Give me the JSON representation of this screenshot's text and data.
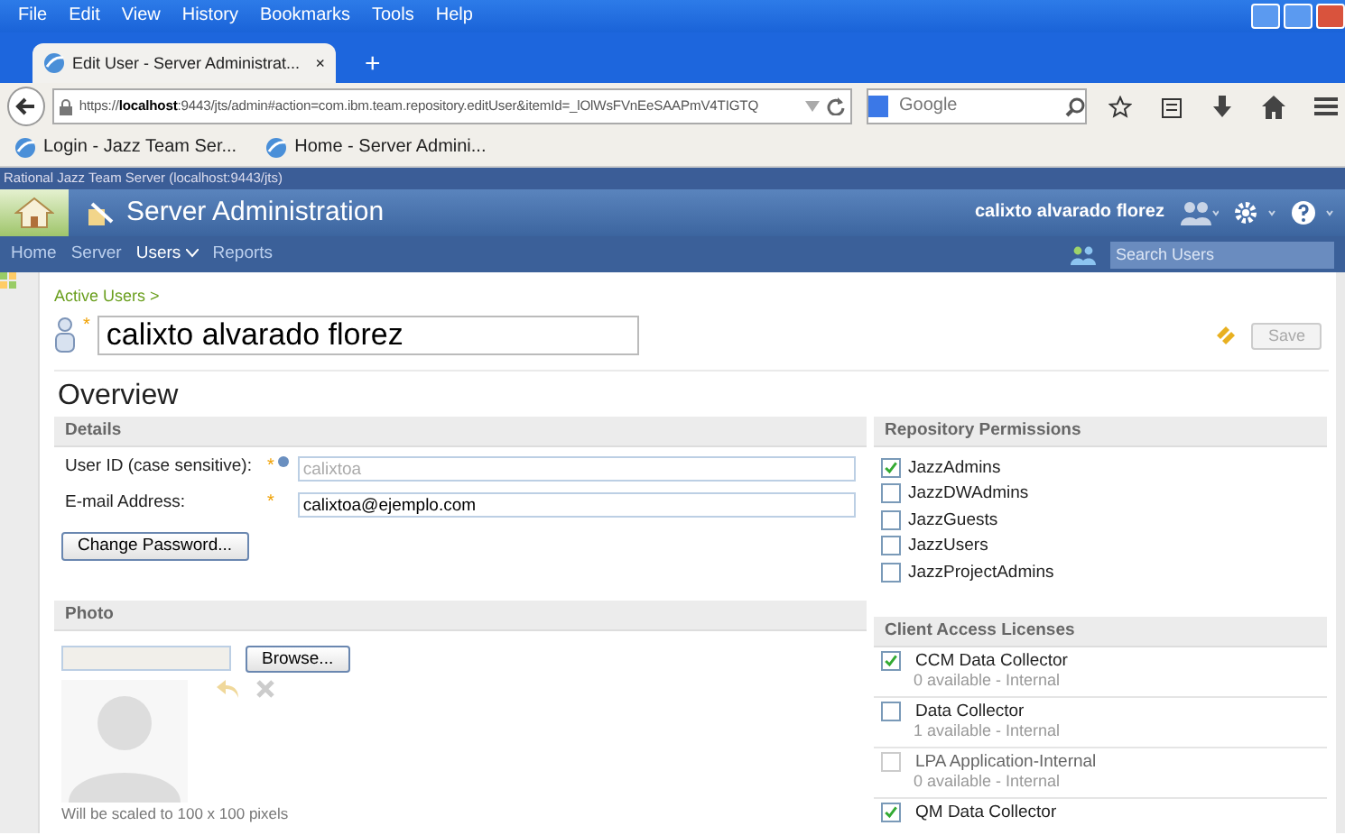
{
  "browser": {
    "menu": [
      "File",
      "Edit",
      "View",
      "History",
      "Bookmarks",
      "Tools",
      "Help"
    ],
    "tab": {
      "title": "Edit User - Server Administrat...",
      "close": "×"
    },
    "new_tab": "+",
    "url": "https://**localhost**:9443/jts/admin#action=com.ibm.team.repository.editUser&itemId=_lOlWsFVnEeSAAPmV4TIGTQ",
    "search": {
      "placeholder": "Google"
    },
    "bookmarks": [
      "Login - Jazz Team Ser...",
      "Home - Server Admini..."
    ]
  },
  "app": {
    "server_title": "Rational Jazz Team Server (localhost:9443/jts)",
    "title": "Server Administration",
    "user": "calixto alvarado florez",
    "nav": [
      {
        "label": "Home",
        "selected": false,
        "dropdown": false
      },
      {
        "label": "Server",
        "selected": false,
        "dropdown": false
      },
      {
        "label": "Users",
        "selected": true,
        "dropdown": true
      },
      {
        "label": "Reports",
        "selected": false,
        "dropdown": false
      }
    ],
    "search": {
      "placeholder": "Search Users"
    }
  },
  "page": {
    "breadcrumb": "Active Users >",
    "name": "calixto alvarado florez",
    "name_mark": "*",
    "save": "Save",
    "heading": "Overview"
  },
  "details": {
    "title": "Details",
    "fields": [
      {
        "label": "User ID (case sensitive):",
        "mark": "*",
        "value": "calixtoa",
        "disabled": true
      },
      {
        "label": "E-mail Address:",
        "mark": "*",
        "value": "calixtoa@ejemplo.com",
        "disabled": false
      }
    ],
    "change_password": "Change Password..."
  },
  "photo": {
    "title": "Photo",
    "browse": "Browse...",
    "note": "Will be scaled to 100 x 100 pixels"
  },
  "permissions": {
    "title": "Repository Permissions",
    "items": [
      {
        "label": "JazzAdmins",
        "checked": true
      },
      {
        "label": "JazzDWAdmins",
        "checked": false
      },
      {
        "label": "JazzGuests",
        "checked": false
      },
      {
        "label": "JazzUsers",
        "checked": false
      },
      {
        "label": "JazzProjectAdmins",
        "checked": false
      }
    ]
  },
  "licenses": {
    "title": "Client Access Licenses",
    "items": [
      {
        "label": "CCM Data Collector",
        "checked": true,
        "disabled": false,
        "detail": "0 available - Internal"
      },
      {
        "label": "Data Collector",
        "checked": false,
        "disabled": false,
        "detail": "1 available - Internal"
      },
      {
        "label": "LPA Application-Internal",
        "checked": false,
        "disabled": true,
        "detail": "0 available - Internal"
      },
      {
        "label": "QM Data Collector",
        "checked": true,
        "disabled": false
      }
    ]
  }
}
